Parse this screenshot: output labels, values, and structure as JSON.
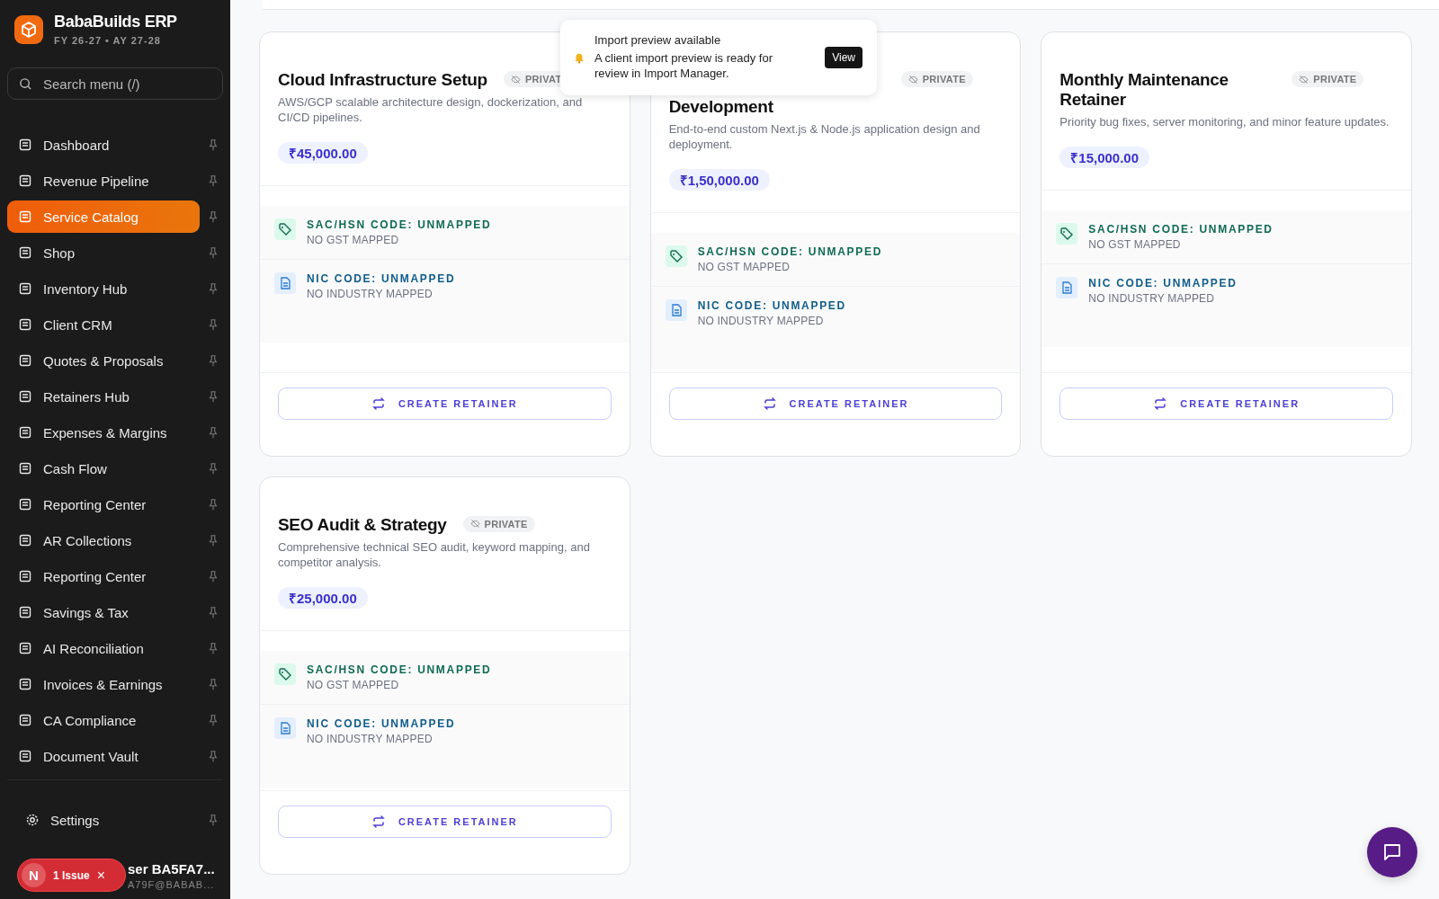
{
  "sidebar": {
    "brand": {
      "name": "BabaBuilds ERP",
      "subtitle": "FY 26-27 • AY 27-28"
    },
    "search": {
      "placeholder": "Search menu (/)"
    },
    "items": [
      {
        "label": "Dashboard",
        "selected": false
      },
      {
        "label": "Revenue Pipeline",
        "selected": false
      },
      {
        "label": "Service Catalog",
        "selected": true
      },
      {
        "label": "Shop",
        "selected": false
      },
      {
        "label": "Inventory Hub",
        "selected": false
      },
      {
        "label": "Client CRM",
        "selected": false
      },
      {
        "label": "Quotes & Proposals",
        "selected": false
      },
      {
        "label": "Retainers Hub",
        "selected": false
      },
      {
        "label": "Expenses & Margins",
        "selected": false
      },
      {
        "label": "Cash Flow",
        "selected": false
      },
      {
        "label": "Reporting Center",
        "selected": false
      },
      {
        "label": "AR Collections",
        "selected": false
      },
      {
        "label": "Reporting Center",
        "selected": false
      },
      {
        "label": "Savings & Tax",
        "selected": false
      },
      {
        "label": "AI Reconciliation",
        "selected": false
      },
      {
        "label": "Invoices & Earnings",
        "selected": false
      },
      {
        "label": "CA Compliance",
        "selected": false
      },
      {
        "label": "Document Vault",
        "selected": false
      }
    ],
    "settings": {
      "label": "Settings"
    },
    "user": {
      "name": "ser BA5FA7...",
      "email": "A79F@BABAB..."
    },
    "issue_badge": {
      "letter": "N",
      "label": "1 Issue",
      "close": "×"
    }
  },
  "cards": [
    {
      "title": "Cloud Infrastructure Setup",
      "visibility": "PRIVAT",
      "description": "AWS/GCP scalable architecture design, dockerization, and CI/CD pipelines.",
      "price": "₹45,000.00",
      "sac_label": "SAC/HSN CODE: UNMAPPED",
      "sac_note": "NO GST MAPPED",
      "nic_label": "NIC CODE: UNMAPPED",
      "nic_note": "NO INDUSTRY MAPPED",
      "button": "CREATE RETAINER"
    },
    {
      "title": "Development",
      "visibility": "PRIVATE",
      "description": "End-to-end custom Next.js & Node.js application design and deployment.",
      "price": "₹1,50,000.00",
      "sac_label": "SAC/HSN CODE: UNMAPPED",
      "sac_note": "NO GST MAPPED",
      "nic_label": "NIC CODE: UNMAPPED",
      "nic_note": "NO INDUSTRY MAPPED",
      "button": "CREATE RETAINER"
    },
    {
      "title": "Monthly Maintenance Retainer",
      "visibility": "PRIVATE",
      "description": "Priority bug fixes, server monitoring, and minor feature updates.",
      "price": "₹15,000.00",
      "sac_label": "SAC/HSN CODE: UNMAPPED",
      "sac_note": "NO GST MAPPED",
      "nic_label": "NIC CODE: UNMAPPED",
      "nic_note": "NO INDUSTRY MAPPED",
      "button": "CREATE RETAINER"
    },
    {
      "title": "SEO Audit & Strategy",
      "visibility": "PRIVATE",
      "description": "Comprehensive technical SEO audit, keyword mapping, and competitor analysis.",
      "price": "₹25,000.00",
      "sac_label": "SAC/HSN CODE: UNMAPPED",
      "sac_note": "NO GST MAPPED",
      "nic_label": "NIC CODE: UNMAPPED",
      "nic_note": "NO INDUSTRY MAPPED",
      "button": "CREATE RETAINER"
    }
  ],
  "toast": {
    "title": "Import preview available",
    "message": "A client import preview is ready for review in Import Manager.",
    "action": "View"
  }
}
